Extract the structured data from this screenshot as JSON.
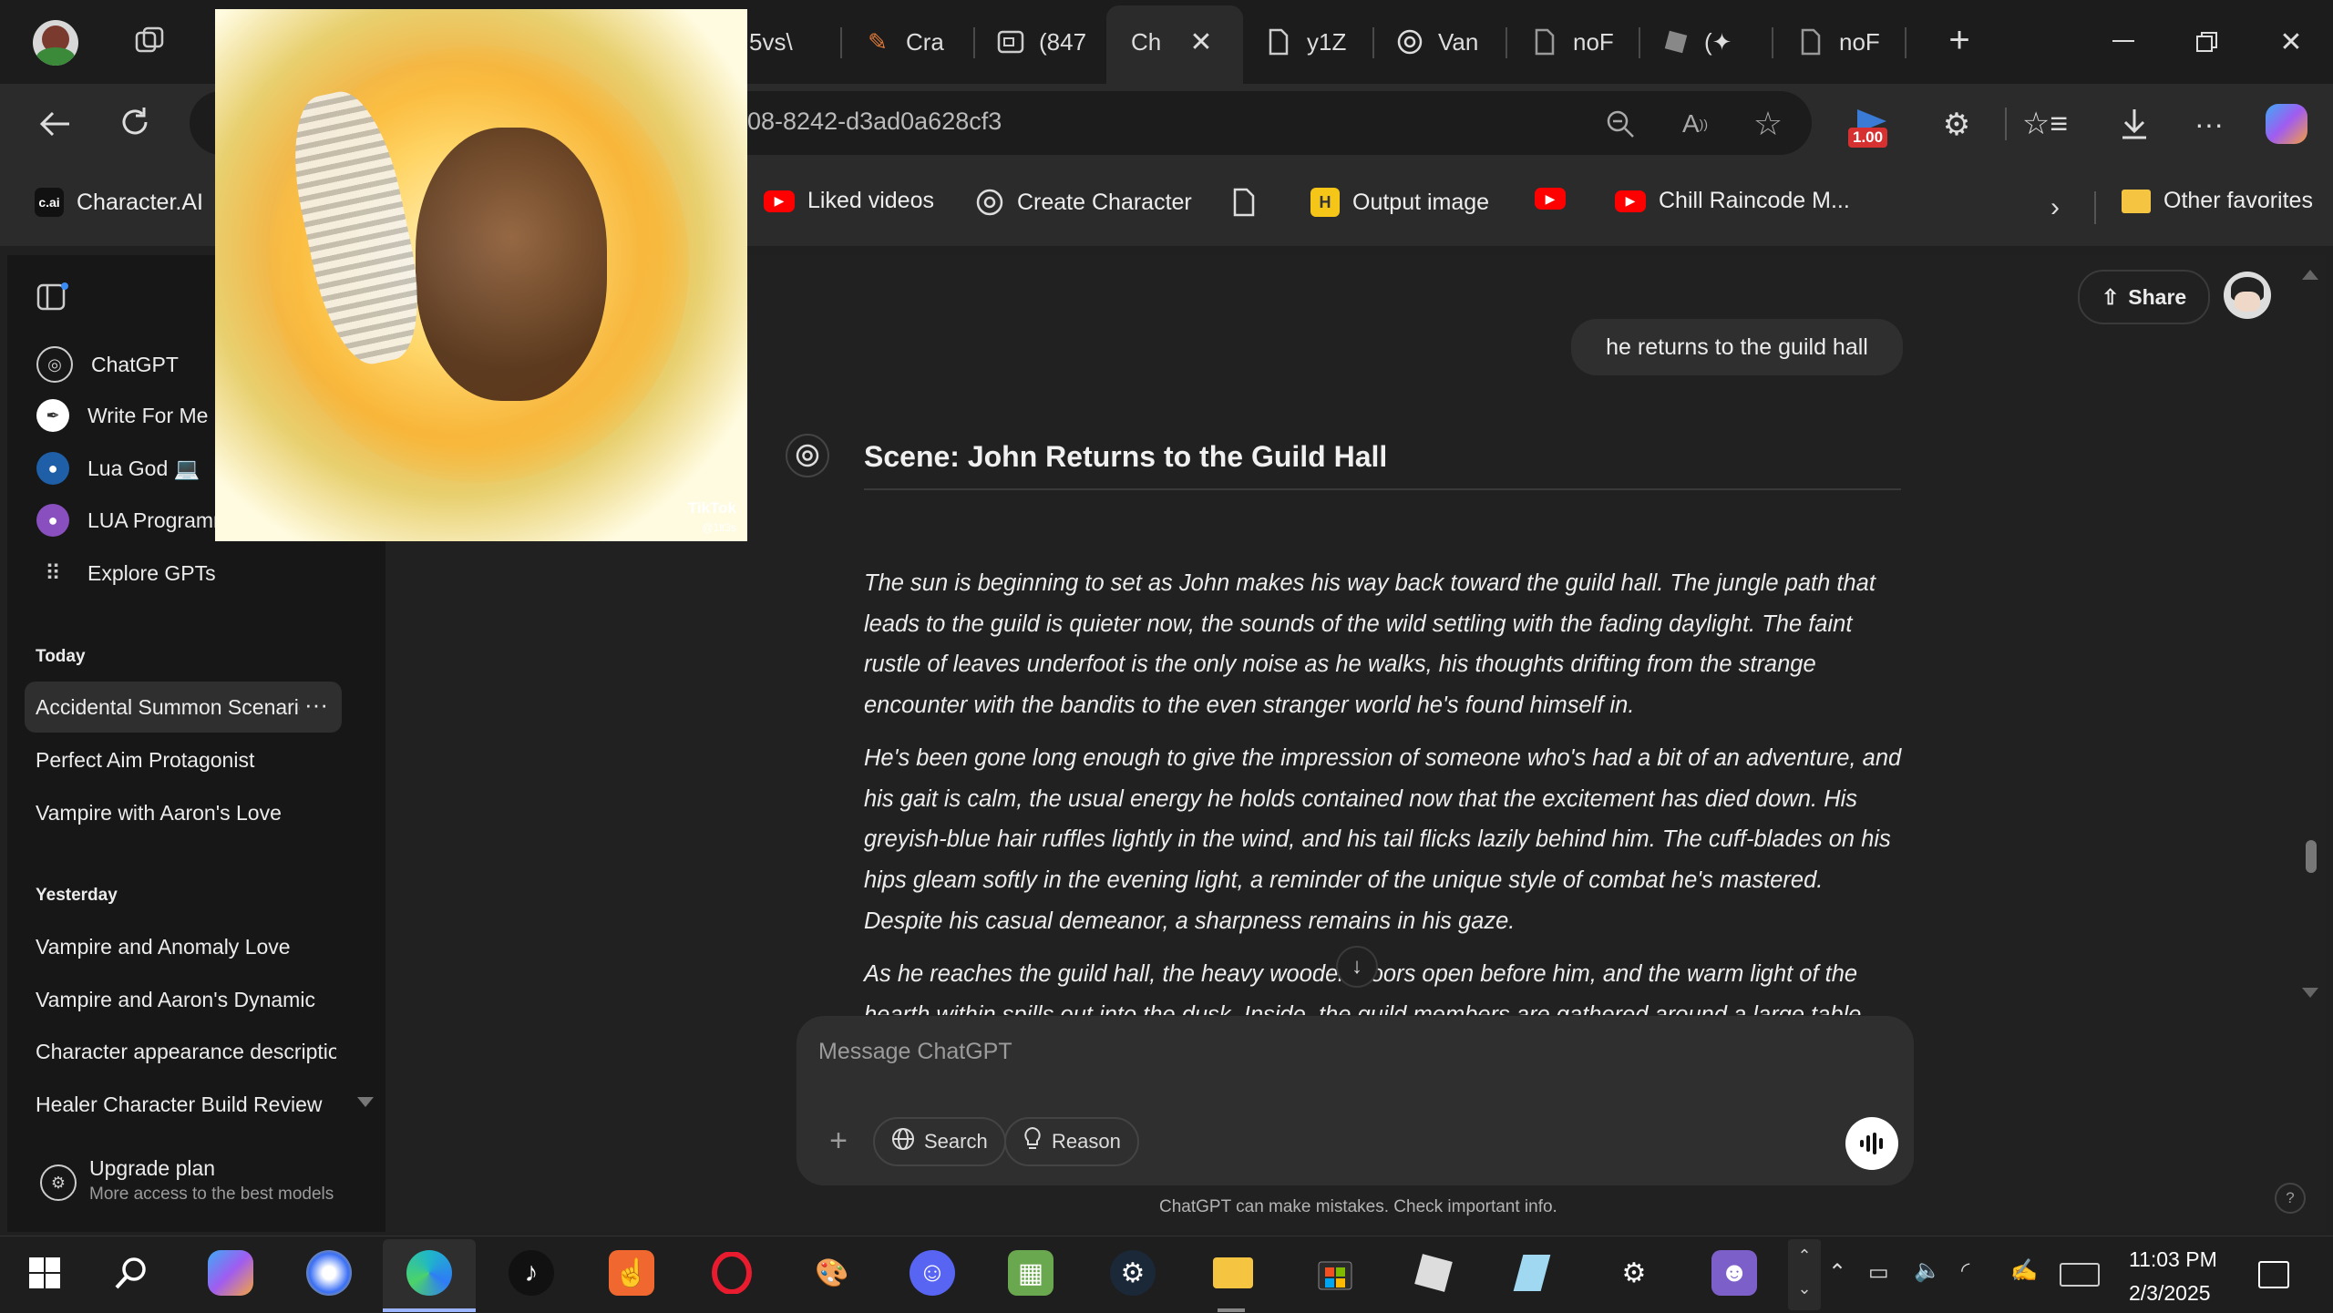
{
  "browser": {
    "tabs": [
      {
        "title": "5vs\\",
        "icon": "page-icon"
      },
      {
        "title": "Cra",
        "icon": "pencil-icon"
      },
      {
        "title": "(847",
        "icon": "gallery-icon"
      },
      {
        "title": "Ch",
        "icon": "chatgpt-icon",
        "active": true
      },
      {
        "title": "y1Z",
        "icon": "page-icon"
      },
      {
        "title": "Van",
        "icon": "chatgpt-icon"
      },
      {
        "title": "noF",
        "icon": "page-icon"
      },
      {
        "title": "(✦",
        "icon": "roblox-icon"
      },
      {
        "title": "noF",
        "icon": "page-icon"
      }
    ],
    "address": "08-8242-d3ad0a628cf3",
    "speed_badge": "1.00",
    "favorites": [
      {
        "label": "Character.AI",
        "icon": "cai-icon"
      },
      {
        "label": "Liked videos",
        "icon": "youtube-icon"
      },
      {
        "label": "Create Character",
        "icon": "chatgpt-icon"
      },
      {
        "label": "",
        "icon": "page-icon"
      },
      {
        "label": "Output image",
        "icon": "yellow-app-icon"
      },
      {
        "label": "",
        "icon": "youtube-icon"
      },
      {
        "label": "Chill Raincode M...",
        "icon": "youtube-icon"
      }
    ],
    "other_favorites": "Other favorites"
  },
  "overlay": {
    "watermark": "TikTok",
    "handle": "@1lt3s"
  },
  "sidebar": {
    "gpts": [
      {
        "label": "ChatGPT"
      },
      {
        "label": "Write For Me"
      },
      {
        "label": "Lua God 💻"
      },
      {
        "label": "LUA Programmer"
      },
      {
        "label": "Explore GPTs"
      }
    ],
    "today_header": "Today",
    "today": [
      "Accidental Summon Scenario",
      "Perfect Aim Protagonist",
      "Vampire with Aaron's Love"
    ],
    "yesterday_header": "Yesterday",
    "yesterday": [
      "Vampire and Anomaly Love",
      "Vampire and Aaron's Dynamic",
      "Character appearance description",
      "Healer Character Build Review"
    ],
    "upgrade_title": "Upgrade plan",
    "upgrade_sub": "More access to the best models"
  },
  "chat": {
    "share": "Share",
    "user_message": "he returns to the guild hall",
    "scene_title": "Scene: John Returns to the Guild Hall",
    "paragraphs": [
      "The sun is beginning to set as John makes his way back toward the guild hall. The jungle path that leads to the guild is quieter now, the sounds of the wild settling with the fading daylight. The faint rustle of leaves underfoot is the only noise as he walks, his thoughts drifting from the strange encounter with the bandits to the even stranger world he's found himself in.",
      "He's been gone long enough to give the impression of someone who's had a bit of an adventure, and his gait is calm, the usual energy he holds contained now that the excitement has died down. His greyish-blue hair ruffles lightly in the wind, and his tail flicks lazily behind him. The cuff-blades on his hips gleam softly in the evening light, a reminder of the unique style of combat he's mastered. Despite his casual demeanor, a sharpness remains in his gaze.",
      "As he reaches the guild hall, the heavy wooden doors open before him, and the warm light of the hearth within spills out into the dusk. Inside, the guild members are gathered around a large table"
    ],
    "composer_placeholder": "Message ChatGPT",
    "search_label": "Search",
    "reason_label": "Reason",
    "disclaimer": "ChatGPT can make mistakes. Check important info.",
    "help": "?"
  },
  "taskbar": {
    "time": "11:03 PM",
    "date": "2/3/2025"
  }
}
